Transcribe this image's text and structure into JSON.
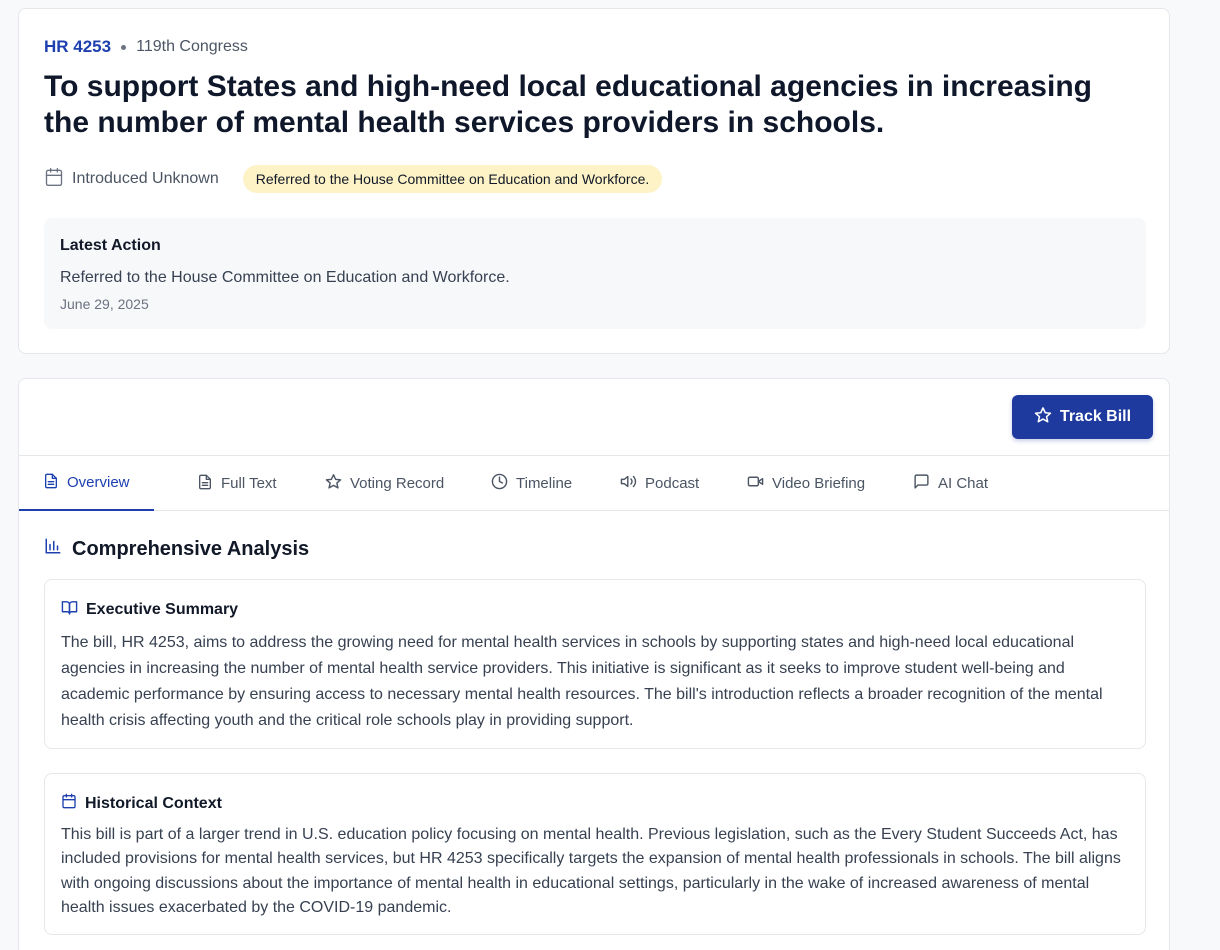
{
  "bill": {
    "number": "HR 4253",
    "congress": "119th Congress",
    "title": "To support States and high-need local educational agencies in increasing the number of mental health services providers in schools.",
    "introduced": "Introduced Unknown",
    "status": "Referred to the House Committee on Education and Workforce."
  },
  "latest_action": {
    "heading": "Latest Action",
    "text": "Referred to the House Committee on Education and Workforce.",
    "date": "June 29, 2025"
  },
  "actions": {
    "track_label": "Track Bill"
  },
  "tabs": [
    {
      "label": "Overview",
      "icon": "file-text-icon",
      "active": true
    },
    {
      "label": "Full Text",
      "icon": "document-icon"
    },
    {
      "label": "Voting Record",
      "icon": "star-icon"
    },
    {
      "label": "Timeline",
      "icon": "clock-icon"
    },
    {
      "label": "Podcast",
      "icon": "speaker-icon"
    },
    {
      "label": "Video Briefing",
      "icon": "video-icon"
    },
    {
      "label": "AI Chat",
      "icon": "chat-icon"
    }
  ],
  "analysis": {
    "heading": "Comprehensive Analysis",
    "executive_summary": {
      "heading": "Executive Summary",
      "text": "The bill, HR 4253, aims to address the growing need for mental health services in schools by supporting states and high-need local educational agencies in increasing the number of mental health service providers. This initiative is significant as it seeks to improve student well-being and academic performance by ensuring access to necessary mental health resources. The bill's introduction reflects a broader recognition of the mental health crisis affecting youth and the critical role schools play in providing support."
    },
    "historical_context": {
      "heading": "Historical Context",
      "text": "This bill is part of a larger trend in U.S. education policy focusing on mental health. Previous legislation, such as the Every Student Succeeds Act, has included provisions for mental health services, but HR 4253 specifically targets the expansion of mental health professionals in schools. The bill aligns with ongoing discussions about the importance of mental health in educational settings, particularly in the wake of increased awareness of mental health issues exacerbated by the COVID-19 pandemic."
    }
  },
  "colors": {
    "accent": "#1e40af",
    "button": "#1e3a9f",
    "badge_bg": "#fdf3c7"
  }
}
